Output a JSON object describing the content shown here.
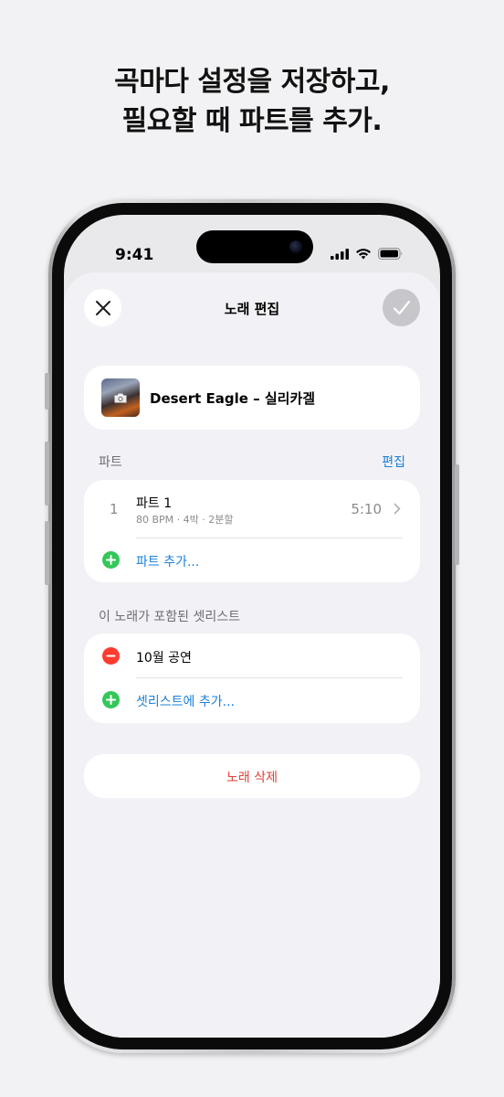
{
  "headline": {
    "line1": "곡마다 설정을 저장하고,",
    "line2": "필요할 때 파트를 추가."
  },
  "status_bar": {
    "time": "9:41"
  },
  "nav": {
    "title": "노래 편집",
    "close_icon": "close-icon",
    "confirm_icon": "checkmark-icon"
  },
  "song": {
    "title": "Desert Eagle – 실리카겔",
    "artwork_icon": "camera-icon"
  },
  "parts": {
    "section_label": "파트",
    "edit_label": "편집",
    "items": [
      {
        "number": "1",
        "title": "파트 1",
        "subtitle": "80 BPM · 4박 · 2분할",
        "duration": "5:10"
      }
    ],
    "add_label": "파트 추가..."
  },
  "setlists": {
    "section_label": "이 노래가 포함된 셋리스트",
    "items": [
      {
        "name": "10월 공연"
      }
    ],
    "add_label": "셋리스트에 추가..."
  },
  "delete_label": "노래 삭제",
  "colors": {
    "accent": "#1b7fd8",
    "destructive": "#e0403a",
    "add_green": "#34c759",
    "remove_red": "#ff3b30"
  }
}
